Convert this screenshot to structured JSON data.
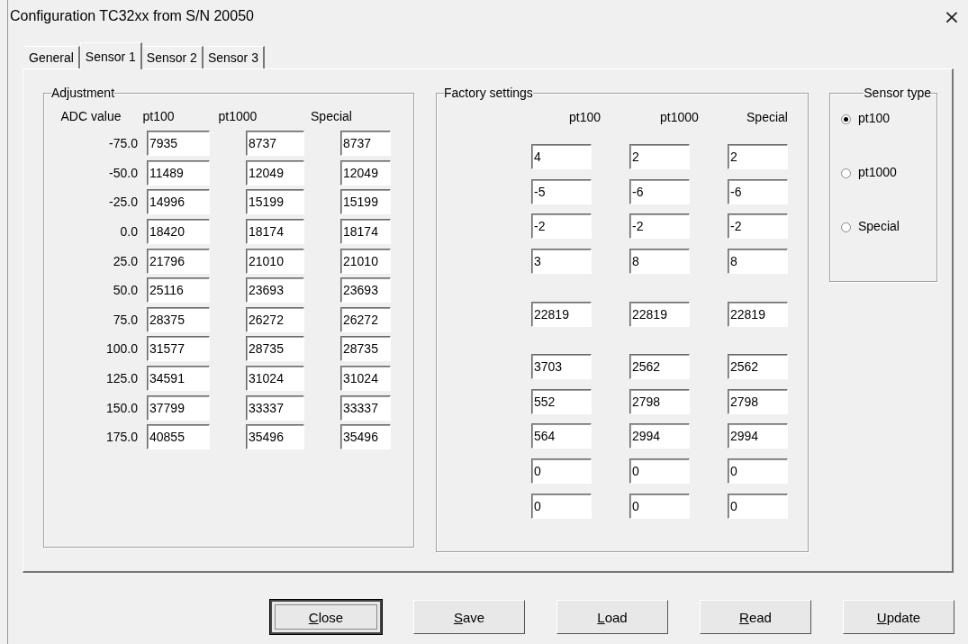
{
  "window": {
    "title": "Configuration TC32xx from S/N 20050",
    "close": "×"
  },
  "tabs": [
    {
      "label": "General",
      "selected": false
    },
    {
      "label": "Sensor 1",
      "selected": true
    },
    {
      "label": "Sensor 2",
      "selected": false
    },
    {
      "label": "Sensor 3",
      "selected": false
    }
  ],
  "adjustment": {
    "title": "Adjustment",
    "columns": [
      "ADC value",
      "pt100",
      "pt1000",
      "Special"
    ],
    "rows": [
      {
        "label": "-75.0",
        "values": [
          "7935",
          "8737",
          "8737"
        ]
      },
      {
        "label": "-50.0",
        "values": [
          "11489",
          "12049",
          "12049"
        ]
      },
      {
        "label": "-25.0",
        "values": [
          "14996",
          "15199",
          "15199"
        ]
      },
      {
        "label": "0.0",
        "values": [
          "18420",
          "18174",
          "18174"
        ]
      },
      {
        "label": "25.0",
        "values": [
          "21796",
          "21010",
          "21010"
        ]
      },
      {
        "label": "50.0",
        "values": [
          "25116",
          "23693",
          "23693"
        ]
      },
      {
        "label": "75.0",
        "values": [
          "28375",
          "26272",
          "26272"
        ]
      },
      {
        "label": "100.0",
        "values": [
          "31577",
          "28735",
          "28735"
        ]
      },
      {
        "label": "125.0",
        "values": [
          "34591",
          "31024",
          "31024"
        ]
      },
      {
        "label": "150.0",
        "values": [
          "37799",
          "33337",
          "33337"
        ]
      },
      {
        "label": "175.0",
        "values": [
          "40855",
          "35496",
          "35496"
        ]
      }
    ]
  },
  "factory_settings": {
    "title": "Factory settings",
    "columns": [
      "pt100",
      "pt1000",
      "Special"
    ],
    "blocks": [
      {
        "rows": [
          [
            "4",
            "2",
            "2"
          ],
          [
            "-5",
            "-6",
            "-6"
          ],
          [
            "-2",
            "-2",
            "-2"
          ],
          [
            "3",
            "8",
            "8"
          ]
        ]
      },
      {
        "rows": [
          [
            "22819",
            "22819",
            "22819"
          ]
        ]
      },
      {
        "rows": [
          [
            "3703",
            "2562",
            "2562"
          ],
          [
            "552",
            "2798",
            "2798"
          ],
          [
            "564",
            "2994",
            "2994"
          ],
          [
            "0",
            "0",
            "0"
          ],
          [
            "0",
            "0",
            "0"
          ]
        ]
      }
    ]
  },
  "sensor_type": {
    "title": "Sensor type",
    "options": [
      {
        "label": "pt100",
        "selected": true
      },
      {
        "label": "pt1000",
        "selected": false
      },
      {
        "label": "Special",
        "selected": false
      }
    ]
  },
  "buttons": [
    {
      "accel": "C",
      "rest": "lose",
      "default": true
    },
    {
      "accel": "S",
      "rest": "ave",
      "default": false
    },
    {
      "accel": "L",
      "rest": "oad",
      "default": false
    },
    {
      "accel": "R",
      "rest": "ead",
      "default": false
    },
    {
      "accel": "U",
      "rest": "pdate",
      "default": false
    }
  ]
}
